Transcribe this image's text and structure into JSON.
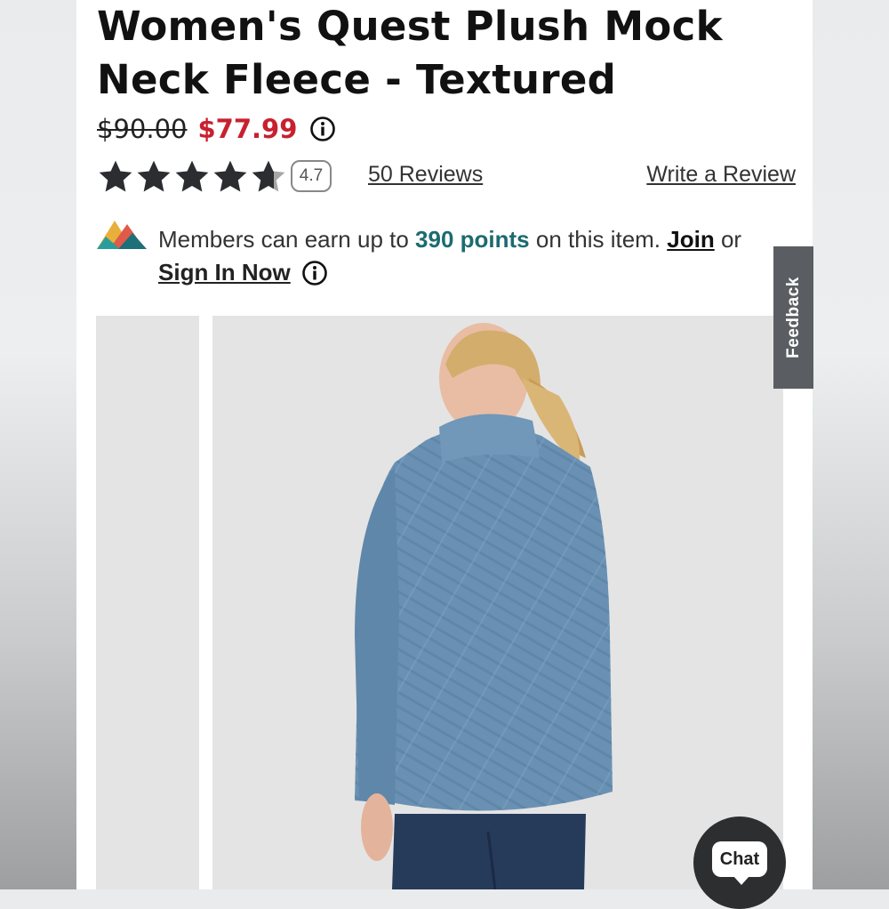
{
  "product": {
    "title": "Women's Quest Plush Mock Neck Fleece - Textured",
    "price_original": "$90.00",
    "price_sale": "$77.99"
  },
  "rating": {
    "value": 4.7,
    "value_label": "4.7",
    "stars_max": 5,
    "reviews_label": "50 Reviews",
    "write_review_label": "Write a Review"
  },
  "membership": {
    "text_before": "Members can earn up to ",
    "points": "390 points",
    "text_after": " on this item. ",
    "join_label": "Join",
    "or_label": " or",
    "signin_label": "Sign In Now"
  },
  "feedback_label": "Feedback",
  "chat_label": "Chat",
  "icons": {
    "info": "info-icon",
    "star": "star-icon",
    "logo": "mountain-logo-icon",
    "chat": "chat-bubble-icon"
  },
  "colors": {
    "sale_price": "#c8202f",
    "points": "#1c6b70",
    "star_filled": "#2b2d30",
    "star_empty": "#a6a6a6",
    "fleece": "#6a91b4"
  }
}
